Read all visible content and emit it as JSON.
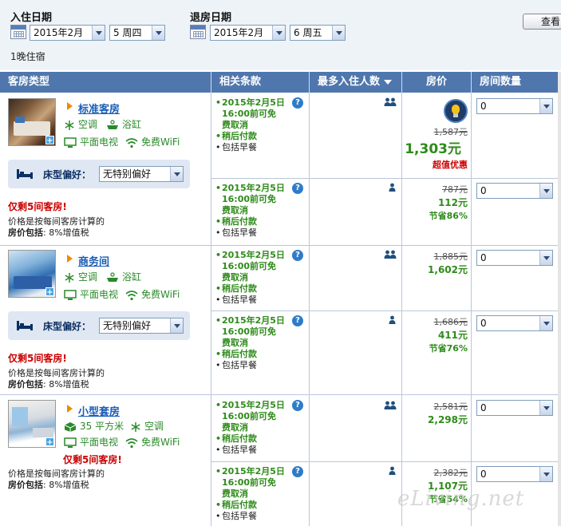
{
  "search": {
    "checkin_label": "入住日期",
    "checkout_label": "退房日期",
    "checkin_month": "2015年2月",
    "checkin_day": "5 周四",
    "checkout_month": "2015年2月",
    "checkout_day": "6 周五",
    "check_button": "查看",
    "nights": "1晚住宿"
  },
  "table": {
    "col_room_type": "客房类型",
    "col_terms": "相关条款",
    "col_max_guests": "最多入住人数",
    "col_price": "房价",
    "col_qty": "房间数量"
  },
  "common": {
    "bed_pref_label": "床型偏好：",
    "bed_pref_value": "无特别偏好",
    "rooms_left": "仅剩5间客房!",
    "note_line1": "价格是按每间客房计算的",
    "note_line2_bold": "房价包括",
    "note_line2_rest": ": 8%增值税",
    "qty_value": "0",
    "term_date": "2015年2月5日",
    "term_time": "16:00前可免",
    "term_cancel": "费取消",
    "term_pay": "稍后付款",
    "term_breakfast": "包括早餐",
    "help_icon": "?"
  },
  "rooms": [
    {
      "name": "标准客房",
      "amenities": [
        "空调",
        "浴缸",
        "平面电视",
        "免费WiFi"
      ],
      "rates": [
        {
          "old": "1,587元",
          "now": "1,303元",
          "tag": "超值优惠"
        },
        {
          "old": "787元",
          "now": "112元",
          "tag": "节省86%"
        }
      ]
    },
    {
      "name": "商务间",
      "amenities": [
        "空调",
        "浴缸",
        "平面电视",
        "免费WiFi"
      ],
      "rates": [
        {
          "old": "1,885元",
          "now": "1,602元",
          "tag": ""
        },
        {
          "old": "1,686元",
          "now": "411元",
          "tag": "节省76%"
        }
      ]
    },
    {
      "name": "小型套房",
      "amenities": [
        "35 平方米",
        "空调",
        "平面电视",
        "免费WiFi"
      ],
      "rates": [
        {
          "old": "2,581元",
          "now": "2,298元",
          "tag": ""
        },
        {
          "old": "2,382元",
          "now": "1,107元",
          "tag": "节省54%"
        }
      ]
    }
  ],
  "watermark": "eLiving.net",
  "colors": {
    "header_bg": "#4f77ae",
    "green": "#2e8b1a",
    "red": "#cc0000",
    "link": "#1a5db5"
  }
}
